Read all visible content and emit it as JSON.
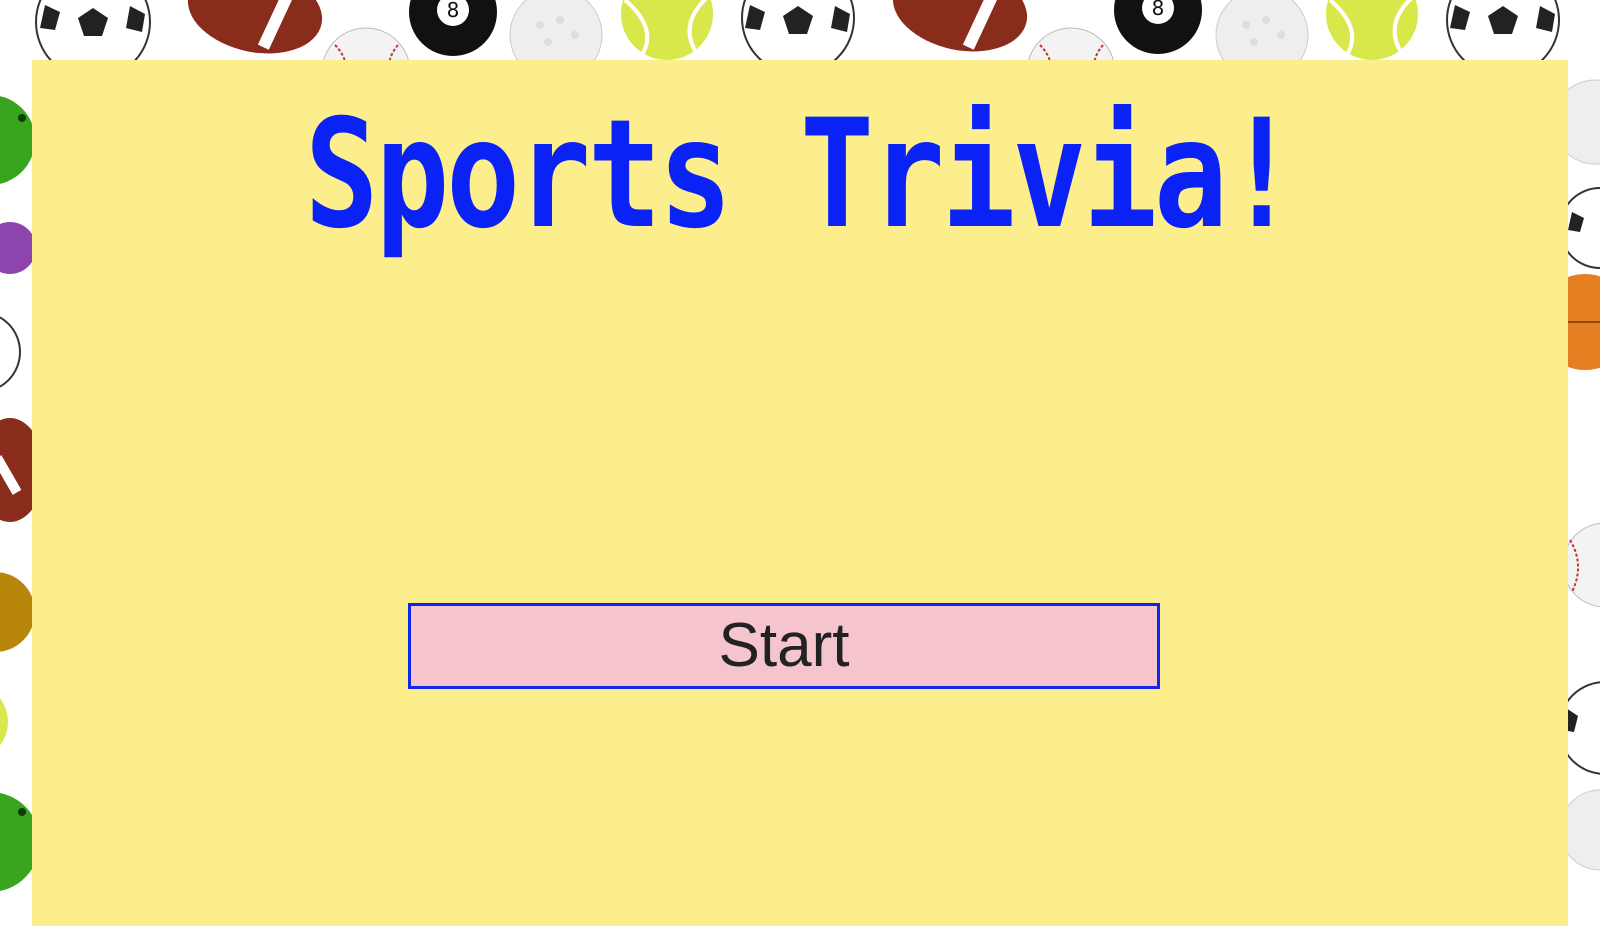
{
  "title": "Sports Trivia!",
  "start_button": {
    "label": "Start"
  },
  "colors": {
    "panel_background": "#fcee8c",
    "title_color": "#0a22f5",
    "button_background": "#f6c4cc",
    "button_border": "#1226e8",
    "button_text": "#222222"
  },
  "background": {
    "pattern": [
      "soccer-ball-icon",
      "football-icon",
      "baseball-icon",
      "eight-ball-icon",
      "golf-ball-icon",
      "tennis-ball-icon",
      "bowling-ball-icon",
      "billiard-ball-icon",
      "basketball-icon"
    ]
  }
}
